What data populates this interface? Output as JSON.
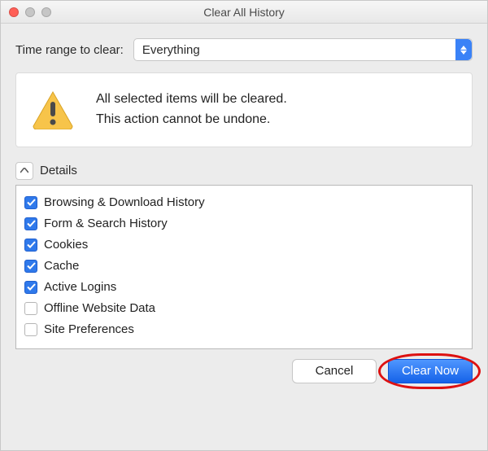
{
  "window": {
    "title": "Clear All History"
  },
  "range": {
    "label": "Time range to clear:",
    "selected": "Everything"
  },
  "warning": {
    "line1": "All selected items will be cleared.",
    "line2": "This action cannot be undone."
  },
  "details": {
    "label": "Details",
    "items": [
      {
        "checked": true,
        "label": "Browsing & Download History"
      },
      {
        "checked": true,
        "label": "Form & Search History"
      },
      {
        "checked": true,
        "label": "Cookies"
      },
      {
        "checked": true,
        "label": "Cache"
      },
      {
        "checked": true,
        "label": "Active Logins"
      },
      {
        "checked": false,
        "label": "Offline Website Data"
      },
      {
        "checked": false,
        "label": "Site Preferences"
      }
    ]
  },
  "buttons": {
    "cancel": "Cancel",
    "clear": "Clear Now"
  }
}
